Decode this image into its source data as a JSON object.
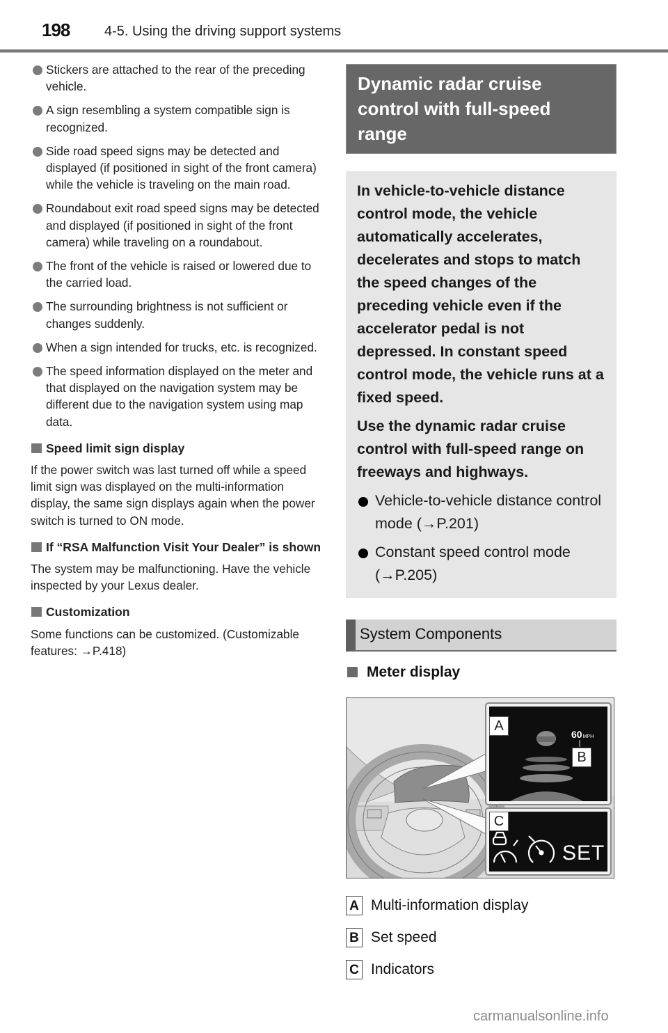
{
  "header": {
    "page_number": "198",
    "section": "4-5. Using the driving support systems"
  },
  "left": {
    "bullets": [
      "Stickers are attached to the rear of the preceding vehicle.",
      "A sign resembling a system compatible sign is recognized.",
      "Side road speed signs may be detected and displayed (if positioned in sight of the front camera) while the vehicle is traveling on the main road.",
      "Roundabout exit road speed signs may be detected and displayed (if positioned in sight of the front camera) while traveling on a roundabout.",
      "The front of the vehicle is raised or lowered due to the carried load.",
      "The surrounding brightness is not sufficient or changes suddenly.",
      "When a sign intended for trucks, etc. is recognized.",
      "The speed information displayed on the meter and that displayed on the navigation system may be different due to the navigation system using map data."
    ],
    "sections": [
      {
        "heading": "Speed limit sign display",
        "body": "If the power switch was last turned off while a speed limit sign was displayed on the multi-information display, the same sign displays again when the power switch is turned to ON mode."
      },
      {
        "heading": "If “RSA Malfunction Visit Your Dealer” is shown",
        "body": "The system may be malfunctioning. Have the vehicle inspected by your Lexus dealer."
      },
      {
        "heading": "Customization",
        "body": "Some functions can be customized. (Customizable features: →P.418)"
      }
    ]
  },
  "right": {
    "title": "Dynamic radar cruise control with full-speed range",
    "intro_p1": "In vehicle-to-vehicle distance control mode, the vehicle automatically accelerates, decelerates and stops to match the speed changes of the preceding vehicle even if the accelerator pedal is not depressed. In constant speed control mode, the vehicle runs at a fixed speed.",
    "intro_p2": "Use the dynamic radar cruise control with full-speed range on freeways and highways.",
    "modes": [
      "Vehicle-to-vehicle distance control mode (→P.201)",
      "Constant speed control mode (→P.205)"
    ],
    "components_heading": "System Components",
    "meter_heading": "Meter display",
    "figure": {
      "callout_labels": [
        "A",
        "B",
        "C"
      ],
      "set_speed": "60",
      "speed_unit": "MPH",
      "indicator_text": "SET"
    },
    "legend": [
      {
        "key": "A",
        "label": "Multi-information display"
      },
      {
        "key": "B",
        "label": "Set speed"
      },
      {
        "key": "C",
        "label": "Indicators"
      }
    ]
  },
  "watermark": "carmanualsonline.info"
}
